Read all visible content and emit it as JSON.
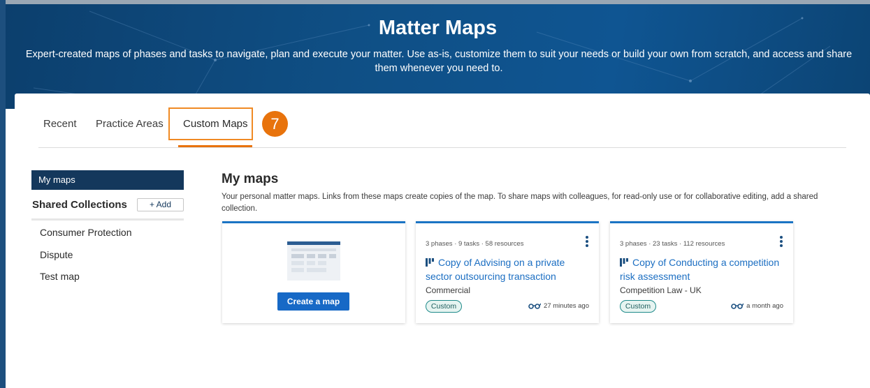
{
  "hero": {
    "title": "Matter Maps",
    "subtitle": "Expert-created maps of phases and tasks to navigate, plan and execute your matter. Use as-is, customize them to suit your needs or build your own from scratch, and access and share them whenever you need to."
  },
  "tabs": [
    {
      "label": "Recent",
      "active": false
    },
    {
      "label": "Practice Areas",
      "active": false
    },
    {
      "label": "Custom Maps",
      "active": true
    }
  ],
  "step_badge": "7",
  "sidebar": {
    "my_maps": "My maps",
    "shared_collections": "Shared Collections",
    "add_label": "+ Add",
    "items": [
      "Consumer Protection",
      "Dispute",
      "Test map"
    ]
  },
  "main": {
    "title": "My maps",
    "description": "Your personal matter maps. Links from these maps create copies of the map. To share maps with colleagues, for read-only use or for collaborative editing, add a shared collection.",
    "create_button": "Create a map",
    "cards": [
      {
        "meta": "3 phases · 9 tasks · 58 resources",
        "title": "Copy of Advising on a private sector outsourcing transaction",
        "practice_area": "Commercial",
        "tag": "Custom",
        "time": "27 minutes ago"
      },
      {
        "meta": "3 phases · 23 tasks · 112 resources",
        "title": "Copy of Conducting a competition risk assessment",
        "practice_area": "Competition Law - UK",
        "tag": "Custom",
        "time": "a month ago"
      }
    ]
  },
  "colors": {
    "hero_bg": "#0f4f85",
    "accent_orange": "#e8730c",
    "link_blue": "#1b6ec2",
    "nav_dark": "#14385c",
    "badge_teal": "#1e8a8a"
  },
  "icons": {
    "card_kebab": "more-vertical-icon",
    "card_map": "map-phases-icon",
    "card_viewed": "glasses-icon"
  }
}
